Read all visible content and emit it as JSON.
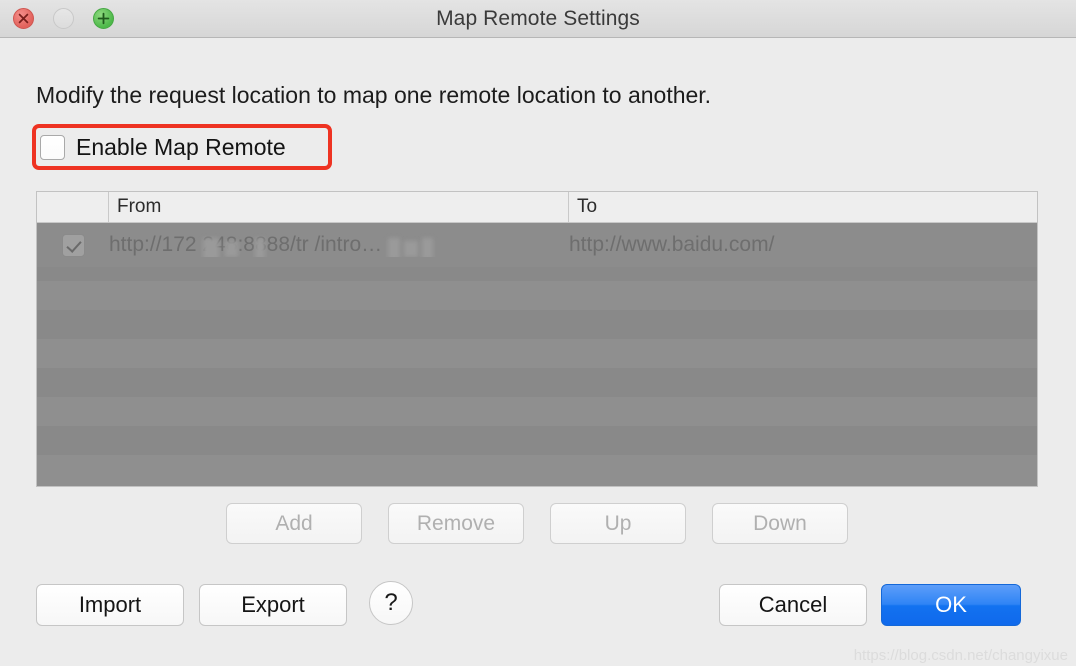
{
  "window": {
    "title": "Map Remote Settings",
    "controls": {
      "close": "close-button",
      "minimize": "minimize-button",
      "zoom": "zoom-button"
    }
  },
  "description": "Modify the request location to map one remote location to another.",
  "enable_option": {
    "label": "Enable Map Remote",
    "checked": false,
    "highlight_color": "#ee3322"
  },
  "table": {
    "columns": [
      "",
      "From",
      "To"
    ],
    "rows": [
      {
        "enabled": true,
        "from": "http://172           248:8888/tr          /intro…",
        "to": "http://www.baidu.com/"
      }
    ]
  },
  "row_buttons": [
    {
      "label": "Add",
      "enabled": false
    },
    {
      "label": "Remove",
      "enabled": false
    },
    {
      "label": "Up",
      "enabled": false
    },
    {
      "label": "Down",
      "enabled": false
    }
  ],
  "footer": {
    "import_label": "Import",
    "export_label": "Export",
    "help_label": "?",
    "cancel_label": "Cancel",
    "ok_label": "OK",
    "ok_color": "#1272f0"
  },
  "watermark": "https://blog.csdn.net/changyixue"
}
